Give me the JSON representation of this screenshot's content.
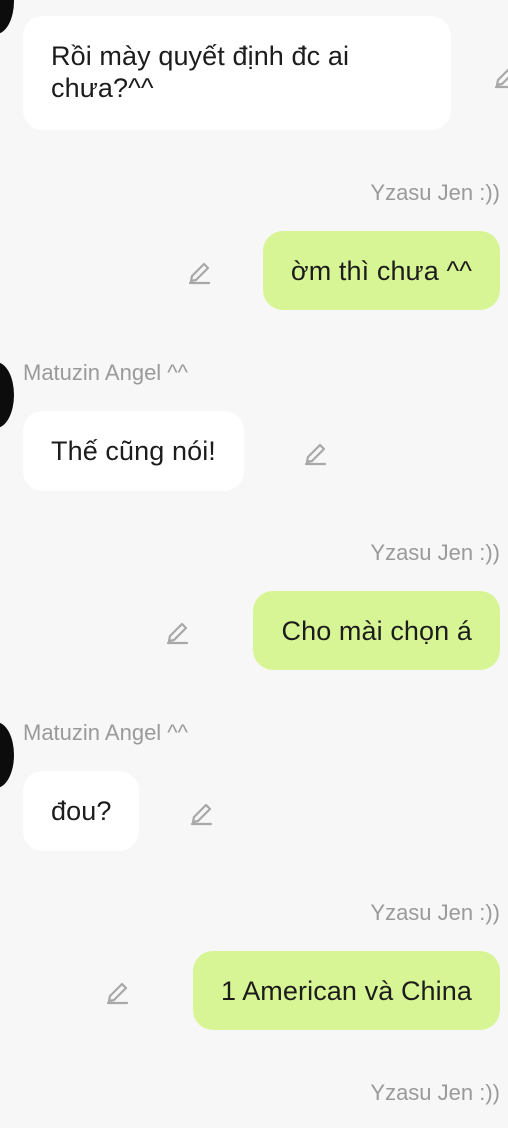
{
  "chat": {
    "messages": [
      {
        "direction": "received",
        "text": "Rồi mày quyết định đc ai chưa?^^"
      },
      {
        "direction": "sent",
        "sender": "Yzasu Jen :))",
        "text": "ờm thì chưa ^^"
      },
      {
        "direction": "received",
        "sender": "Matuzin Angel ^^",
        "text": "Thế cũng nói!"
      },
      {
        "direction": "sent",
        "sender": "Yzasu Jen :))",
        "text": "Cho mài chọn á"
      },
      {
        "direction": "received",
        "sender": "Matuzin Angel ^^",
        "text": "đou?"
      },
      {
        "direction": "sent",
        "sender": "Yzasu Jen :))",
        "text": "1 American và China"
      }
    ],
    "trailing_sender": "Yzasu Jen :))"
  },
  "icons": {
    "edit": "pencil-edit-icon",
    "avatar": "avatar"
  },
  "colors": {
    "background": "#f7f7f7",
    "received_bubble": "#ffffff",
    "sent_bubble": "#d8f595",
    "sender_text": "#9a9a9a",
    "message_text": "#1c1c1c"
  }
}
